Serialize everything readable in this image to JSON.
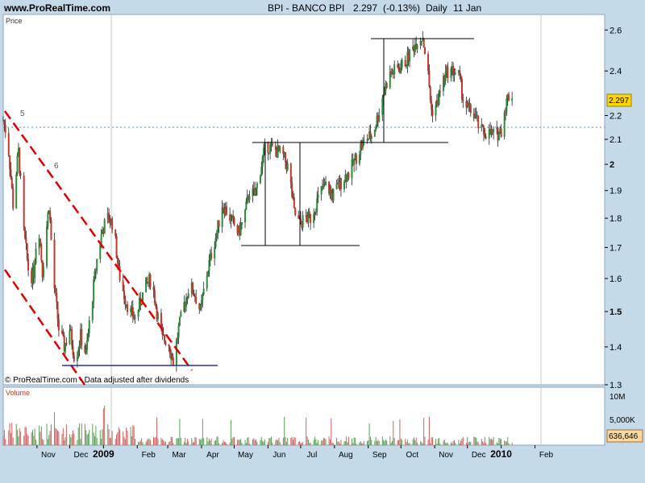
{
  "header": {
    "site": "www.ProRealTime.com",
    "instrument": "BPI - BANCO BPI",
    "last_price": "2.297",
    "change": "(-0.13%)",
    "period": "Daily",
    "date": "11 Jan"
  },
  "price_panel": {
    "label": "Price",
    "footer_note": "© ProRealTime.com - Data adjusted after dividends",
    "current_price_box": "2.297"
  },
  "volume_panel": {
    "label": "Volume",
    "current_volume_box": "636,646"
  },
  "colors": {
    "panel_bg": "#ffffff",
    "frame_bg": "#c5dae9",
    "up_candle": "#2e8b3a",
    "down_candle": "#c0392b",
    "trendline_red": "#e00000",
    "support_blue": "#2233aa",
    "reference_dotted": "#6a8fb5",
    "price_box_bg": "#ffd700",
    "volume_box_bg": "#ffd9a0"
  },
  "chart_data": {
    "type": "candlestick",
    "title": "BPI - BANCO BPI",
    "y_ticks": [
      "2.6",
      "2.4",
      "2.2",
      "2.1",
      "2",
      "1.9",
      "1.8",
      "1.7",
      "1.6",
      "1.5",
      "1.4",
      "1.3"
    ],
    "y_scale": "log",
    "ylim": [
      1.3,
      2.68
    ],
    "volume_ticks": [
      "10M",
      "5,000K"
    ],
    "x_tick_labels": [
      "Nov",
      "Dec",
      "2009",
      "Feb",
      "Mar",
      "Apr",
      "May",
      "Jun",
      "Jul",
      "Aug",
      "Sep",
      "Oct",
      "Nov",
      "Dec",
      "2010",
      "Feb"
    ],
    "reference_price": 2.15,
    "price_path": [
      [
        "2008-10-01",
        2.18
      ],
      [
        "2008-10-05",
        2.1
      ],
      [
        "2008-10-10",
        1.85
      ],
      [
        "2008-10-15",
        2.05
      ],
      [
        "2008-10-20",
        1.75
      ],
      [
        "2008-10-25",
        1.6
      ],
      [
        "2008-10-29",
        1.62
      ],
      [
        "2008-11-02",
        1.8
      ],
      [
        "2008-11-06",
        1.62
      ],
      [
        "2008-11-12",
        1.85
      ],
      [
        "2008-11-16",
        1.6
      ],
      [
        "2008-11-21",
        1.45
      ],
      [
        "2008-11-26",
        1.4
      ],
      [
        "2008-12-01",
        1.45
      ],
      [
        "2008-12-06",
        1.36
      ],
      [
        "2008-12-11",
        1.43
      ],
      [
        "2008-12-16",
        1.38
      ],
      [
        "2008-12-21",
        1.52
      ],
      [
        "2008-12-26",
        1.66
      ],
      [
        "2008-12-31",
        1.76
      ],
      [
        "2009-01-05",
        1.8
      ],
      [
        "2009-01-10",
        1.78
      ],
      [
        "2009-01-15",
        1.62
      ],
      [
        "2009-01-20",
        1.55
      ],
      [
        "2009-01-25",
        1.5
      ],
      [
        "2009-01-30",
        1.48
      ],
      [
        "2009-02-04",
        1.53
      ],
      [
        "2009-02-09",
        1.58
      ],
      [
        "2009-02-14",
        1.6
      ],
      [
        "2009-02-19",
        1.5
      ],
      [
        "2009-02-24",
        1.42
      ],
      [
        "2009-03-01",
        1.42
      ],
      [
        "2009-03-06",
        1.36
      ],
      [
        "2009-03-11",
        1.45
      ],
      [
        "2009-03-16",
        1.52
      ],
      [
        "2009-03-21",
        1.58
      ],
      [
        "2009-03-26",
        1.55
      ],
      [
        "2009-03-31",
        1.5
      ],
      [
        "2009-04-05",
        1.6
      ],
      [
        "2009-04-10",
        1.68
      ],
      [
        "2009-04-15",
        1.75
      ],
      [
        "2009-04-20",
        1.85
      ],
      [
        "2009-04-25",
        1.82
      ],
      [
        "2009-04-30",
        1.78
      ],
      [
        "2009-05-05",
        1.75
      ],
      [
        "2009-05-10",
        1.8
      ],
      [
        "2009-05-15",
        1.9
      ],
      [
        "2009-05-20",
        1.88
      ],
      [
        "2009-05-25",
        1.98
      ],
      [
        "2009-05-30",
        2.08
      ],
      [
        "2009-06-05",
        2.06
      ],
      [
        "2009-06-10",
        2.05
      ],
      [
        "2009-06-15",
        2.03
      ],
      [
        "2009-06-20",
        1.98
      ],
      [
        "2009-06-25",
        1.82
      ],
      [
        "2009-06-30",
        1.78
      ],
      [
        "2009-07-05",
        1.8
      ],
      [
        "2009-07-10",
        1.8
      ],
      [
        "2009-07-15",
        1.85
      ],
      [
        "2009-07-20",
        1.9
      ],
      [
        "2009-07-25",
        1.92
      ],
      [
        "2009-07-30",
        1.88
      ],
      [
        "2009-08-05",
        1.92
      ],
      [
        "2009-08-10",
        1.95
      ],
      [
        "2009-08-15",
        1.97
      ],
      [
        "2009-08-20",
        2.02
      ],
      [
        "2009-08-25",
        2.07
      ],
      [
        "2009-08-30",
        2.1
      ],
      [
        "2009-09-05",
        2.12
      ],
      [
        "2009-09-10",
        2.2
      ],
      [
        "2009-09-15",
        2.3
      ],
      [
        "2009-09-20",
        2.38
      ],
      [
        "2009-09-25",
        2.4
      ],
      [
        "2009-10-01",
        2.42
      ],
      [
        "2009-10-06",
        2.45
      ],
      [
        "2009-10-11",
        2.5
      ],
      [
        "2009-10-16",
        2.55
      ],
      [
        "2009-10-21",
        2.57
      ],
      [
        "2009-10-26",
        2.38
      ],
      [
        "2009-10-29",
        2.22
      ],
      [
        "2009-11-03",
        2.25
      ],
      [
        "2009-11-08",
        2.35
      ],
      [
        "2009-11-13",
        2.4
      ],
      [
        "2009-11-18",
        2.4
      ],
      [
        "2009-11-23",
        2.38
      ],
      [
        "2009-11-28",
        2.25
      ],
      [
        "2009-12-03",
        2.22
      ],
      [
        "2009-12-08",
        2.2
      ],
      [
        "2009-12-13",
        2.13
      ],
      [
        "2009-12-18",
        2.13
      ],
      [
        "2009-12-23",
        2.12
      ],
      [
        "2009-12-28",
        2.12
      ],
      [
        "2010-01-01",
        2.14
      ],
      [
        "2010-01-04",
        2.22
      ],
      [
        "2010-01-07",
        2.28
      ],
      [
        "2010-01-11",
        2.297
      ]
    ],
    "last_volume": 636646
  }
}
